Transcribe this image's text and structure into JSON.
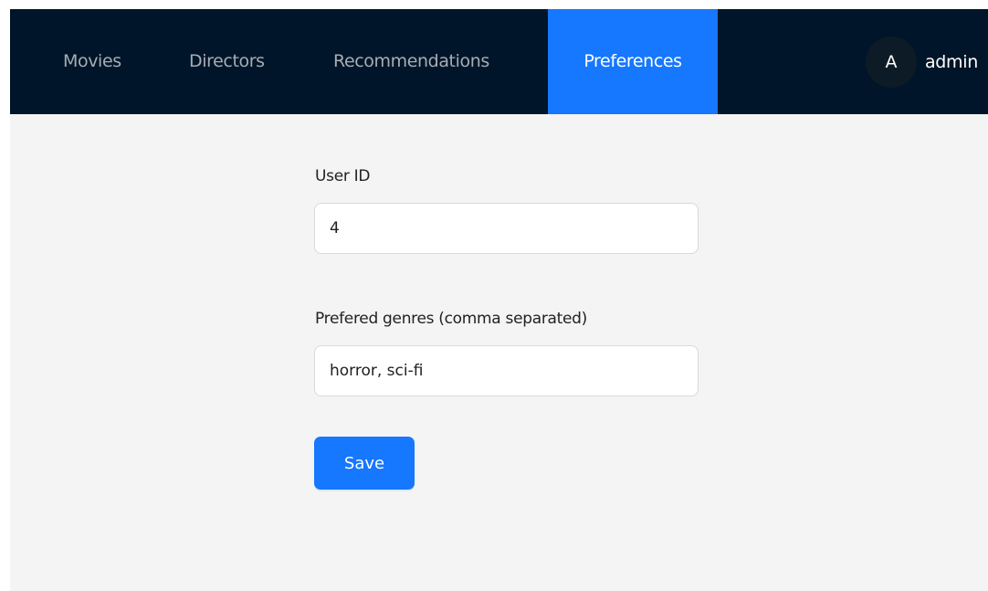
{
  "nav": {
    "items": [
      {
        "label": "Movies"
      },
      {
        "label": "Directors"
      },
      {
        "label": "Recommendations"
      },
      {
        "label": "Preferences",
        "active": true
      }
    ]
  },
  "user": {
    "avatar_initial": "A",
    "name": "admin"
  },
  "form": {
    "user_id_label": "User ID",
    "user_id_value": "4",
    "genres_label": "Prefered genres (comma separated)",
    "genres_value": "horror, sci-fi",
    "save_label": "Save"
  },
  "colors": {
    "navbar_bg": "#001529",
    "accent": "#1677ff",
    "page_bg": "#f4f4f4"
  }
}
